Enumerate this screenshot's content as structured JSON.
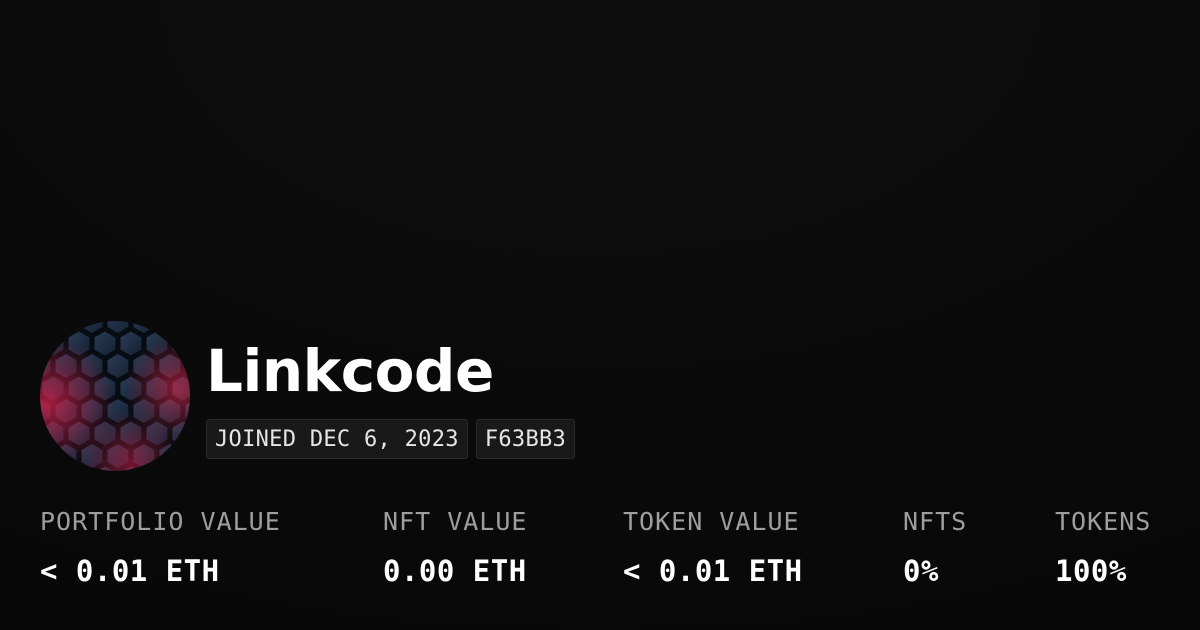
{
  "profile": {
    "name": "Linkcode",
    "joined": "JOINED DEC 6, 2023",
    "code": "F63BB3"
  },
  "stats": {
    "portfolio": {
      "label": "PORTFOLIO VALUE",
      "value": "< 0.01 ETH"
    },
    "nft_value": {
      "label": "NFT VALUE",
      "value": "0.00 ETH"
    },
    "token_value": {
      "label": "TOKEN VALUE",
      "value": "< 0.01 ETH"
    },
    "nfts": {
      "label": "NFTS",
      "value": "0%"
    },
    "tokens": {
      "label": "TOKENS",
      "value": "100%"
    }
  },
  "colors": {
    "background": "#0b0b0b",
    "label": "#9e9e9e",
    "value": "#ffffff",
    "tag_bg": "#191919",
    "avatar_accent": "#e0264a"
  }
}
